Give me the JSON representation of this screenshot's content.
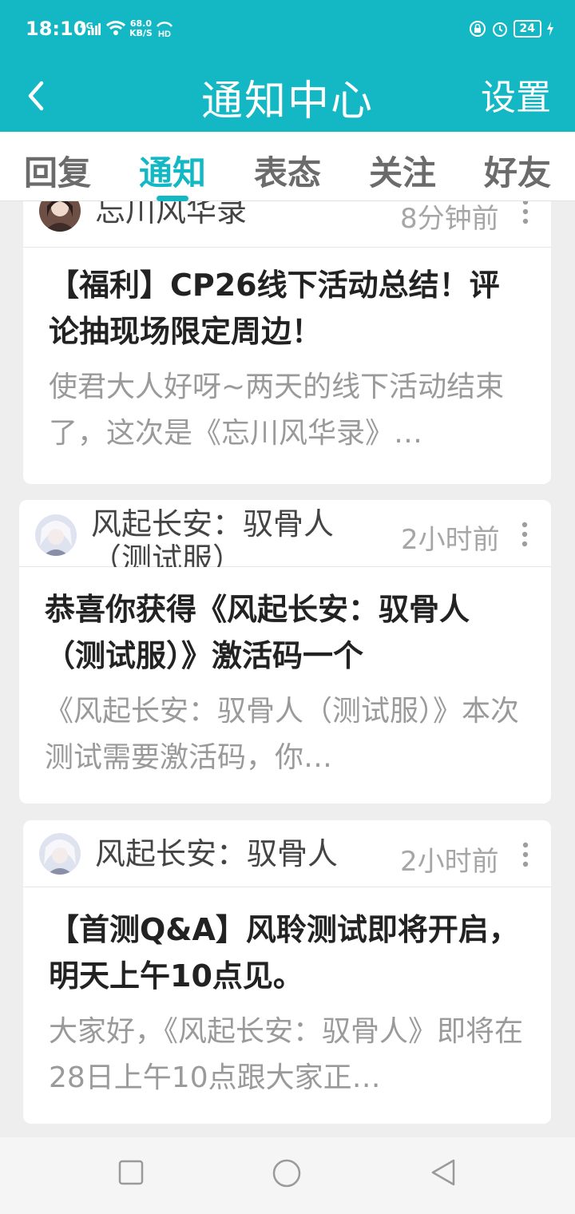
{
  "status_bar": {
    "time": "18:10",
    "network": "4G",
    "speed_value": "68.0",
    "speed_unit": "KB/S",
    "hd": "HD",
    "battery": "24"
  },
  "header": {
    "back_icon": "back-arrow-icon",
    "title": "通知中心",
    "settings_label": "设置"
  },
  "tabs": [
    {
      "label": "回复",
      "active": false
    },
    {
      "label": "通知",
      "active": true
    },
    {
      "label": "表态",
      "active": false
    },
    {
      "label": "关注",
      "active": false
    },
    {
      "label": "好友",
      "active": false
    }
  ],
  "notifications": [
    {
      "author": "忘川风华录",
      "time": "8分钟前",
      "title": "【福利】CP26线下活动总结！评论抽现场限定周边！",
      "body": "使君大人好呀~两天的线下活动结束了，这次是《忘川风华录》…"
    },
    {
      "author": "风起长安：驭骨人（测试服）",
      "time": "2小时前",
      "title": "恭喜你获得《风起长安：驭骨人（测试服）》激活码一个",
      "body": "《风起长安：驭骨人（测试服）》本次测试需要激活码，你…"
    },
    {
      "author": "风起长安：驭骨人",
      "time": "2小时前",
      "title": "【首测Q&A】风聆测试即将开启，明天上午10点见。",
      "body": "大家好，《风起长安：驭骨人》即将在28日上午10点跟大家正…"
    }
  ],
  "colors": {
    "accent": "#14b8c4",
    "background": "#eeeeee",
    "muted_text": "#9a9a9a"
  }
}
